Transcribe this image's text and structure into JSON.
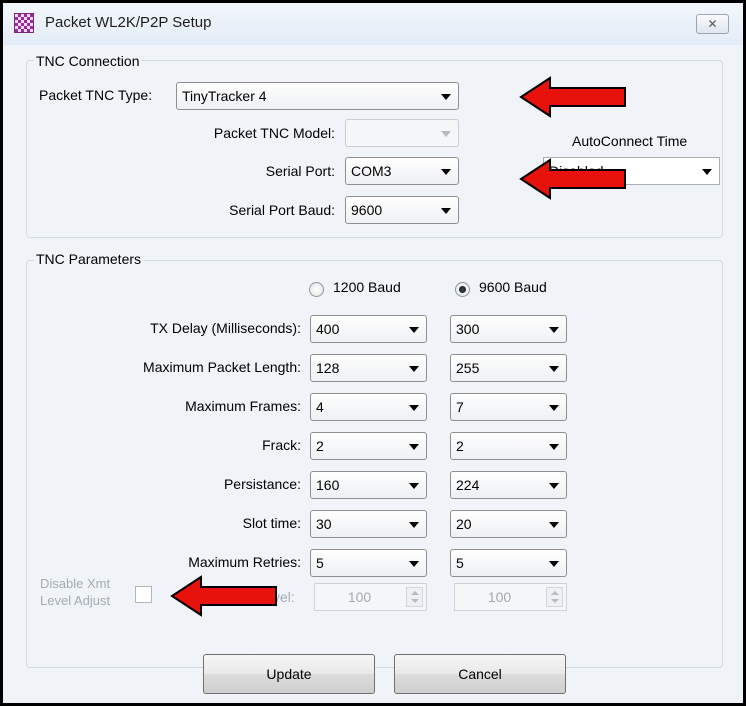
{
  "window": {
    "title": "Packet WL2K/P2P Setup",
    "close_glyph": "✕"
  },
  "tnc_connection": {
    "group_title": "TNC Connection",
    "packet_tnc_type": {
      "label": "Packet TNC Type:",
      "value": "TinyTracker 4"
    },
    "packet_tnc_model": {
      "label": "Packet TNC Model:",
      "value": ""
    },
    "serial_port": {
      "label": "Serial Port:",
      "value": "COM3"
    },
    "serial_port_baud": {
      "label": "Serial Port Baud:",
      "value": "9600"
    }
  },
  "autoconnect": {
    "label": "AutoConnect Time",
    "value": "Disabled"
  },
  "tnc_parameters": {
    "group_title": "TNC Parameters",
    "baud_options": [
      {
        "label": "1200 Baud",
        "selected": false
      },
      {
        "label": "9600 Baud",
        "selected": true
      }
    ],
    "rows": [
      {
        "label": "TX Delay (Milliseconds):",
        "v1200": "400",
        "v9600": "300"
      },
      {
        "label": "Maximum Packet Length:",
        "v1200": "128",
        "v9600": "255"
      },
      {
        "label": "Maximum Frames:",
        "v1200": "4",
        "v9600": "7"
      },
      {
        "label": "Frack:",
        "v1200": "2",
        "v9600": "2"
      },
      {
        "label": "Persistance:",
        "v1200": "160",
        "v9600": "224"
      },
      {
        "label": "Slot time:",
        "v1200": "30",
        "v9600": "20"
      },
      {
        "label": "Maximum Retries:",
        "v1200": "5",
        "v9600": "5"
      }
    ],
    "disable_xmt": {
      "label_line1": "Disable Xmt",
      "label_line2": "Level Adjust",
      "checked": false
    },
    "level_label_partial": "vel:",
    "level_1200": "100",
    "level_9600": "100"
  },
  "buttons": {
    "update": "Update",
    "cancel": "Cancel"
  },
  "colors": {
    "annotation_arrow": "#e8120c",
    "window_bg": "#f0f4f9",
    "disabled_text": "#a4aab3"
  }
}
